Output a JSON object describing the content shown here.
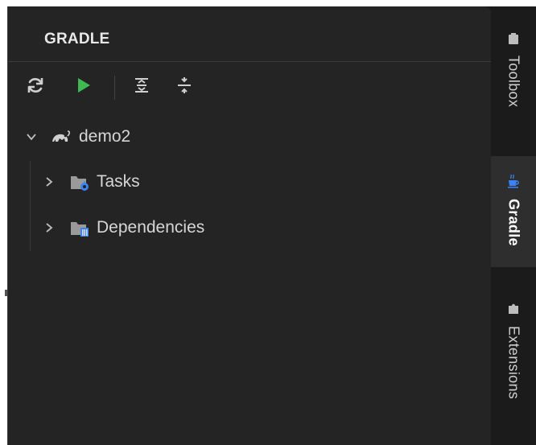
{
  "panel": {
    "title": "GRADLE"
  },
  "toolbar": {
    "buttons": [
      {
        "name": "refresh",
        "icon": "refresh-icon"
      },
      {
        "name": "run",
        "icon": "play-icon"
      },
      {
        "name": "expand-all",
        "icon": "expand-all-icon"
      },
      {
        "name": "collapse-all",
        "icon": "collapse-all-icon"
      }
    ]
  },
  "tree": {
    "root": {
      "label": "demo2",
      "icon": "gradle-elephant-icon",
      "expanded": true
    },
    "children": [
      {
        "label": "Tasks",
        "icon": "tasks-folder-icon",
        "expanded": false
      },
      {
        "label": "Dependencies",
        "icon": "dependencies-folder-icon",
        "expanded": false
      }
    ]
  },
  "sidebar": {
    "tabs": [
      {
        "label": "Toolbox",
        "icon": "toolbox-icon",
        "active": false
      },
      {
        "label": "Gradle",
        "icon": "gradle-coffee-icon",
        "active": true
      },
      {
        "label": "Extensions",
        "icon": "extensions-icon",
        "active": false
      }
    ]
  },
  "colors": {
    "panel_bg": "#242425",
    "side_bg": "#1b1b1c",
    "run_green": "#3fb950",
    "accent_blue": "#3b82f6"
  }
}
